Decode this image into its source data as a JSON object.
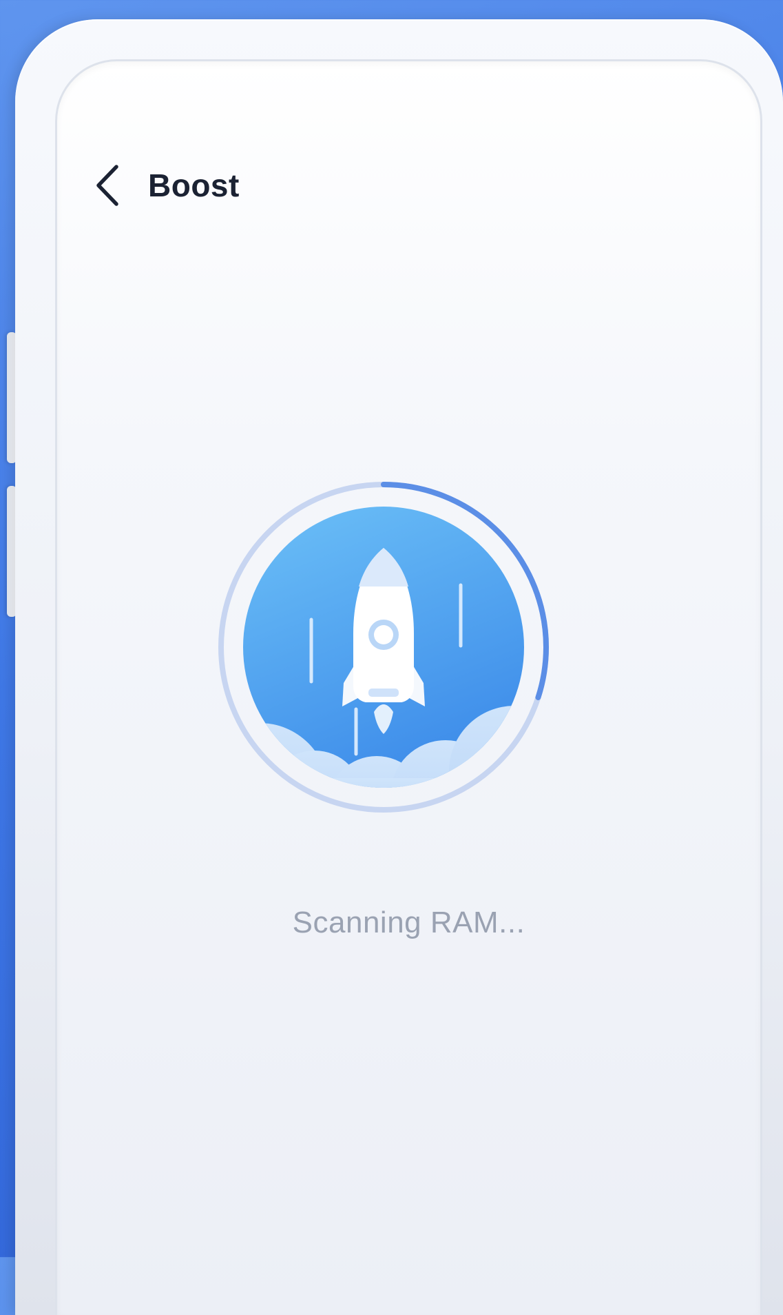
{
  "app": {
    "title": "Boost"
  },
  "header": {
    "back_icon": "chevron-left-icon",
    "title": "Boost"
  },
  "scan": {
    "icon": "rocket-icon",
    "progress_fraction": 0.3,
    "status_text": "Scanning RAM..."
  },
  "colors": {
    "background_blue": "#3f78e6",
    "circle_blue": "#4aa0f0",
    "progress_arc": "#5b8ee6",
    "title_text": "#1b2233",
    "status_text": "#9aa2b2"
  }
}
